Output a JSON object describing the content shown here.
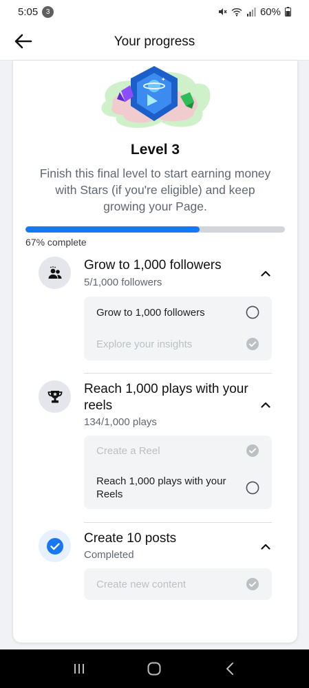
{
  "status_bar": {
    "time": "5:05",
    "notification_count": "3",
    "battery": "60%"
  },
  "header": {
    "title": "Your progress",
    "back_icon": "arrow-left-icon"
  },
  "level": {
    "title": "Level 3",
    "description": "Finish this final level to start earning money with Stars (if you're eligible) and keep growing your Page.",
    "progress_fraction": 0.67,
    "progress_label": "67% complete"
  },
  "tasks": [
    {
      "icon": "people-icon",
      "title": "Grow to 1,000 followers",
      "subtitle": "5/1,000 followers",
      "expanded": true,
      "subtasks": [
        {
          "label": "Grow to 1,000 followers",
          "done": false
        },
        {
          "label": "Explore your insights",
          "done": true
        }
      ]
    },
    {
      "icon": "trophy-icon",
      "title": "Reach 1,000 plays with your reels",
      "subtitle": "134/1,000 plays",
      "expanded": true,
      "subtasks": [
        {
          "label": "Create a Reel",
          "done": true
        },
        {
          "label": "Reach 1,000 plays with your Reels",
          "done": false
        }
      ]
    },
    {
      "icon": "check-circle-icon",
      "title": "Create 10 posts",
      "subtitle": "Completed",
      "expanded": true,
      "subtasks": [
        {
          "label": "Create new content",
          "done": true
        }
      ]
    }
  ],
  "colors": {
    "accent": "#1877f2",
    "track": "#d2d5d9",
    "muted_text": "#606770",
    "disabled_text": "#bcc0c4"
  },
  "nav": {
    "recent_icon": "recent-apps-icon",
    "home_icon": "home-icon",
    "back_icon": "nav-back-icon"
  }
}
